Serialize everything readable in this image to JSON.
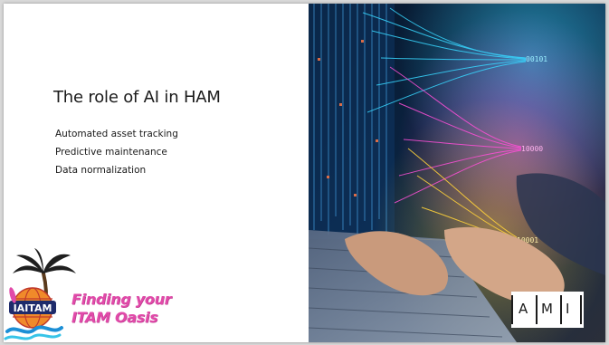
{
  "slide": {
    "title": "The role of AI in HAM",
    "bullets": [
      "Automated asset tracking",
      "Predictive maintenance",
      "Data normalization"
    ]
  },
  "conference_logo": {
    "badge_text": "IAITAM",
    "tagline_line1": "Finding your",
    "tagline_line2": "ITAM Oasis"
  },
  "image_overlay": {
    "binary_top": "00101",
    "binary_mid": "10000",
    "binary_bottom": "10001"
  },
  "company_logo": {
    "letters": [
      "A",
      "M",
      "I"
    ]
  },
  "colors": {
    "brand_pink": "#e14aa9",
    "stream_cyan": "#38d7ff",
    "stream_magenta": "#ff4fd8",
    "stream_yellow": "#ffd23a",
    "image_bg_dark": "#0b1f3a"
  }
}
